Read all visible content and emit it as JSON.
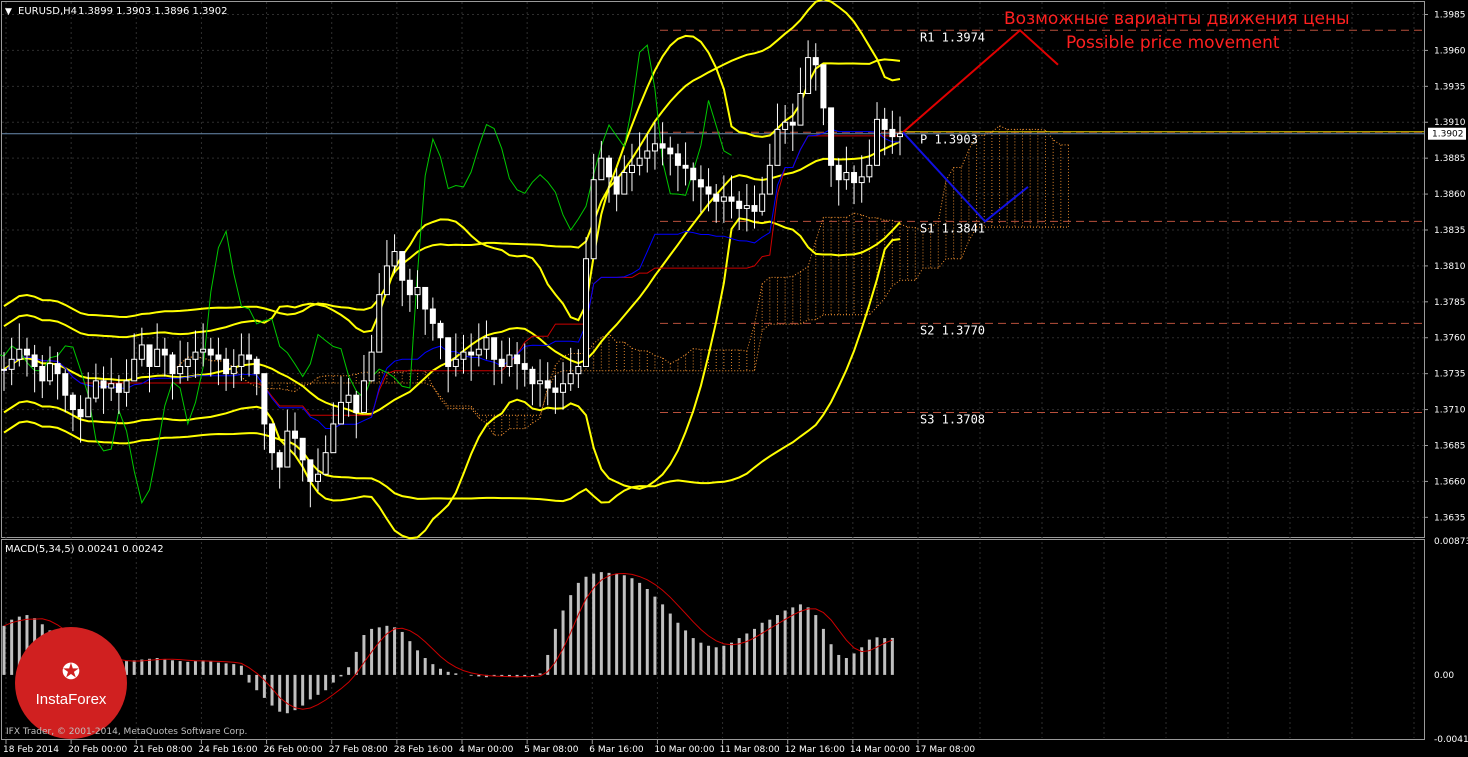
{
  "header": {
    "title": "EURUSD,H4",
    "ohlc": "1.3899 1.3903 1.3896 1.3902",
    "macd_label": "MACD(5,34,5) 0.00241 0.00242"
  },
  "annotation": {
    "line1": "Возможные варианты движения цены",
    "line2": "Possible price movement"
  },
  "levels": [
    {
      "name": "R1",
      "label": "R1 1.3974",
      "value": 1.3974
    },
    {
      "name": "P",
      "label": "P 1.3903",
      "value": 1.3903
    },
    {
      "name": "S1",
      "label": "S1 1.3841",
      "value": 1.3841
    },
    {
      "name": "S2",
      "label": "S2 1.3770",
      "value": 1.377
    },
    {
      "name": "S3",
      "label": "S3 1.3708",
      "value": 1.3708
    }
  ],
  "current_price": {
    "label": "1.3902",
    "value": 1.3902
  },
  "price_axis": {
    "min": 1.3622,
    "max": 1.3993,
    "ticks": [
      "1.3985",
      "1.3960",
      "1.3935",
      "1.3910",
      "1.3885",
      "1.3860",
      "1.3835",
      "1.3810",
      "1.3785",
      "1.3760",
      "1.3735",
      "1.3710",
      "1.3685",
      "1.3660",
      "1.3635"
    ]
  },
  "macd_axis": {
    "min": -0.00418,
    "max": 0.00873,
    "ticks": [
      "0.00873",
      "0.00",
      "-0.00418"
    ]
  },
  "time_axis": [
    "18 Feb 2014",
    "20 Feb 00:00",
    "21 Feb 08:00",
    "24 Feb 16:00",
    "26 Feb 00:00",
    "27 Feb 08:00",
    "28 Feb 16:00",
    "4 Mar 00:00",
    "5 Mar 08:00",
    "6 Mar 16:00",
    "10 Mar 00:00",
    "11 Mar 08:00",
    "12 Mar 16:00",
    "14 Mar 00:00",
    "17 Mar 08:00"
  ],
  "logo": {
    "text": "InstaForex"
  },
  "copyright": "IFX Trader, © 2001-2014, MetaQuotes Software Corp.",
  "colors": {
    "background": "#000000",
    "candle": "#ffffff",
    "bollinger": "#ffff00",
    "kijun": "#cc0000",
    "tenkan": "#0000ff",
    "chikou": "#00c800",
    "cloud": "#ff9933",
    "pivot_lines": "#b8503c",
    "macd_hist": "#c0c0c0",
    "macd_signal": "#cc0000",
    "forecast_up": "#e00000",
    "forecast_down": "#1010e0",
    "logo": "#d02020"
  },
  "chart_data": {
    "type": "candlestick",
    "symbol": "EURUSD",
    "timeframe": "H4",
    "closes": [
      1.3738,
      1.3745,
      1.3752,
      1.3748,
      1.374,
      1.373,
      1.3742,
      1.3735,
      1.372,
      1.371,
      1.3705,
      1.3718,
      1.373,
      1.3725,
      1.3728,
      1.3722,
      1.373,
      1.3745,
      1.3755,
      1.374,
      1.3752,
      1.3748,
      1.3735,
      1.374,
      1.3745,
      1.375,
      1.3752,
      1.3748,
      1.3745,
      1.3735,
      1.374,
      1.3748,
      1.3745,
      1.3735,
      1.37,
      1.368,
      1.367,
      1.3695,
      1.369,
      1.3675,
      1.366,
      1.3665,
      1.368,
      1.37,
      1.3715,
      1.372,
      1.3708,
      1.373,
      1.375,
      1.379,
      1.381,
      1.382,
      1.38,
      1.379,
      1.3795,
      1.378,
      1.377,
      1.376,
      1.374,
      1.3745,
      1.375,
      1.3748,
      1.3752,
      1.376,
      1.3745,
      1.374,
      1.3748,
      1.3742,
      1.3738,
      1.3728,
      1.373,
      1.3725,
      1.3722,
      1.3728,
      1.3735,
      1.374,
      1.3815,
      1.387,
      1.3885,
      1.3872,
      1.386,
      1.3875,
      1.388,
      1.3885,
      1.389,
      1.3895,
      1.3892,
      1.3888,
      1.388,
      1.3878,
      1.387,
      1.3865,
      1.386,
      1.3855,
      1.3858,
      1.3855,
      1.385,
      1.3852,
      1.3848,
      1.386,
      1.388,
      1.3905,
      1.391,
      1.3908,
      1.393,
      1.3955,
      1.395,
      1.392,
      1.388,
      1.387,
      1.3875,
      1.3868,
      1.3872,
      1.388,
      1.3912,
      1.3905,
      1.39,
      1.3902
    ],
    "macd_histogram": [
      0.0032,
      0.0036,
      0.0038,
      0.0039,
      0.0037,
      0.0033,
      0.0029,
      0.0025,
      0.0021,
      0.0018,
      0.0015,
      0.0013,
      0.0011,
      0.00095,
      0.00085,
      0.00085,
      0.0009,
      0.00095,
      0.001,
      0.00105,
      0.0011,
      0.001,
      0.00095,
      0.0009,
      0.00085,
      0.0009,
      0.00095,
      0.0009,
      0.0008,
      0.00075,
      0.0007,
      0.0006,
      -0.0005,
      -0.001,
      -0.0015,
      -0.002,
      -0.0024,
      -0.0025,
      -0.0023,
      -0.002,
      -0.0016,
      -0.0013,
      -0.001,
      -0.0005,
      -0.0001,
      0.0005,
      0.0015,
      0.0026,
      0.003,
      0.0031,
      0.0032,
      0.0031,
      0.0028,
      0.0022,
      0.0016,
      0.0011,
      0.0007,
      0.0004,
      0.0002,
      0.0001,
      0.0,
      -5e-05,
      -0.0001,
      -0.00015,
      -0.0001,
      -0.0001,
      -0.0001,
      -0.00015,
      -0.0001,
      -0.0001,
      0.0001,
      0.0013,
      0.003,
      0.0042,
      0.0052,
      0.006,
      0.0064,
      0.0066,
      0.0067,
      0.00665,
      0.0066,
      0.0065,
      0.0063,
      0.006,
      0.0056,
      0.0051,
      0.0046,
      0.004,
      0.0034,
      0.0029,
      0.0024,
      0.0021,
      0.0019,
      0.0018,
      0.0019,
      0.0021,
      0.0024,
      0.0027,
      0.003,
      0.0034,
      0.0036,
      0.0039,
      0.0042,
      0.0044,
      0.0046,
      0.0044,
      0.0039,
      0.003,
      0.002,
      0.0013,
      0.0011,
      0.0014,
      0.0018,
      0.0023,
      0.00245,
      0.0024,
      0.00241
    ],
    "forecast": {
      "up": [
        [
          1.3903,
          1.3974
        ],
        [
          1.3974,
          1.395
        ]
      ],
      "down": [
        [
          1.3903,
          1.3841
        ],
        [
          1.3841,
          1.3865
        ]
      ]
    },
    "price_range": [
      1.3622,
      1.3993
    ],
    "macd_range": [
      -0.00418,
      0.00873
    ]
  }
}
